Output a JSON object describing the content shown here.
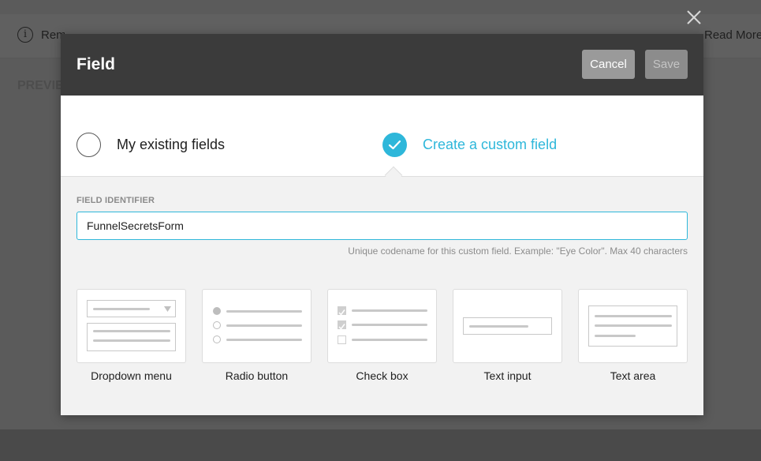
{
  "background": {
    "notice_text": "Remember! Use your own fields. The actual form design will be updated",
    "read_more": "Read More",
    "preview_label": "PREVIEW"
  },
  "modal": {
    "title": "Field",
    "cancel_label": "Cancel",
    "save_label": "Save",
    "choices": {
      "existing": {
        "label": "My existing fields",
        "selected": false
      },
      "custom": {
        "label": "Create a custom field",
        "selected": true
      }
    },
    "identifier": {
      "label": "FIELD IDENTIFIER",
      "value": "FunnelSecretsForm",
      "hint": "Unique codename for this custom field. Example: \"Eye Color\". Max 40 characters"
    },
    "field_types": [
      {
        "id": "dropdown",
        "label": "Dropdown menu"
      },
      {
        "id": "radio",
        "label": "Radio button"
      },
      {
        "id": "checkbox",
        "label": "Check box"
      },
      {
        "id": "text-input",
        "label": "Text input"
      },
      {
        "id": "text-area",
        "label": "Text area"
      }
    ]
  },
  "colors": {
    "accent": "#2eb7da",
    "header": "#3b3b3b",
    "overlay": "#5b5b5b"
  },
  "icons": {
    "close": "close-icon",
    "info": "info-icon",
    "check": "check-icon"
  }
}
